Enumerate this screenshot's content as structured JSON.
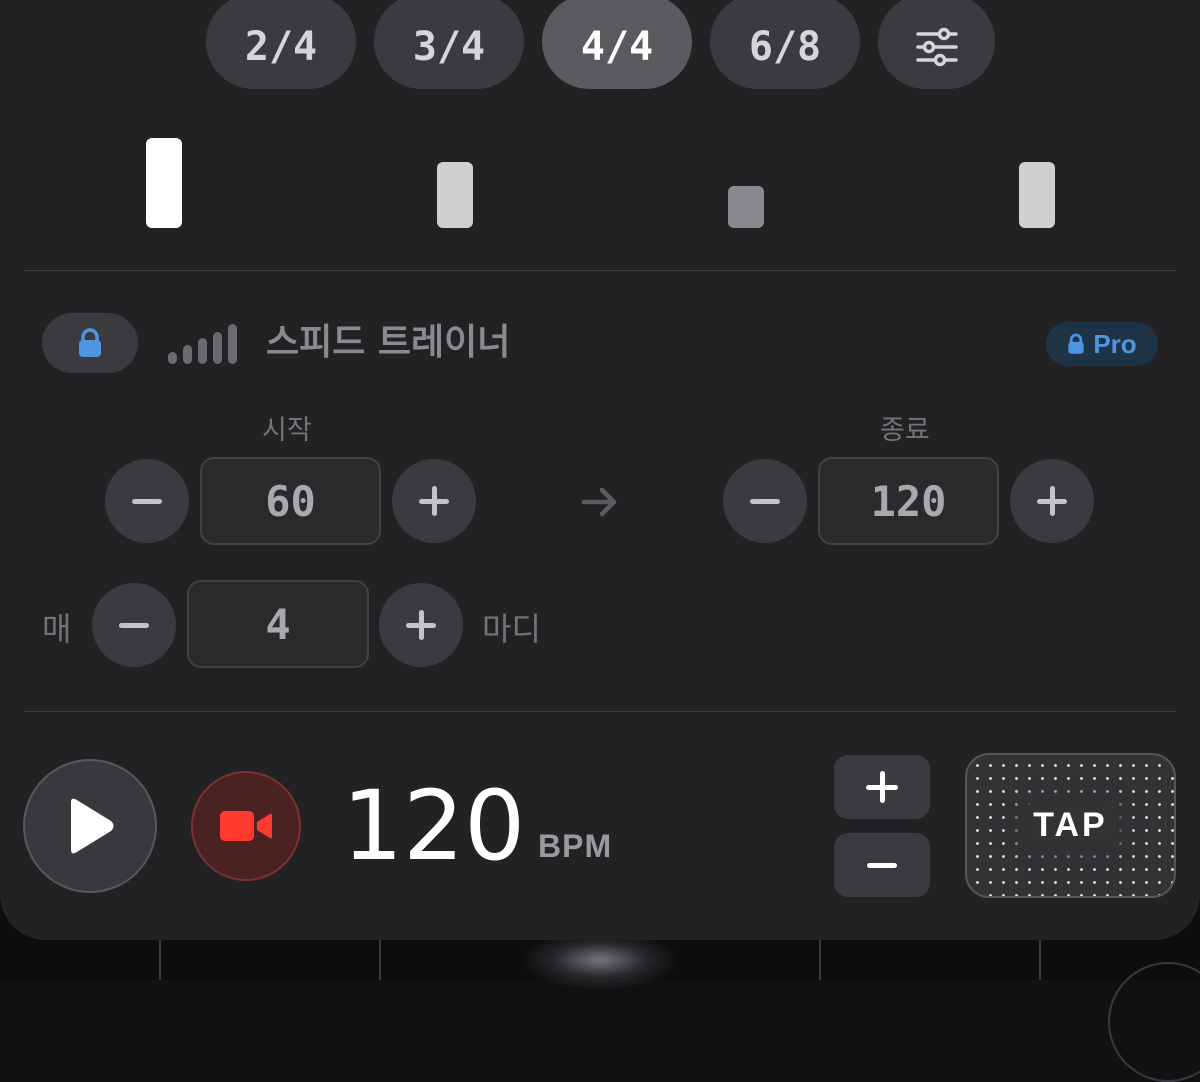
{
  "time_signatures": [
    {
      "label": "2/4",
      "active": false
    },
    {
      "label": "3/4",
      "active": false
    },
    {
      "label": "4/4",
      "active": true
    },
    {
      "label": "6/8",
      "active": false
    }
  ],
  "settings_icon": "sliders-icon",
  "beats": [
    {
      "accent": "strong",
      "color": "#ffffff"
    },
    {
      "accent": "medium",
      "color": "#cfcfd2"
    },
    {
      "accent": "weak",
      "color": "#8a8a8e"
    },
    {
      "accent": "medium",
      "color": "#cfcfd2"
    }
  ],
  "speed_trainer": {
    "title": "스피드 트레이너",
    "pro_label": "Pro",
    "start_label": "시작",
    "start_value": "60",
    "end_label": "종료",
    "end_value": "120",
    "every_prefix": "매",
    "every_value": "4",
    "every_suffix": "마디"
  },
  "transport": {
    "bpm": "120",
    "bpm_unit": "BPM",
    "tap_label": "TAP"
  },
  "colors": {
    "accent_blue": "#4e97e0",
    "record_red": "#ff3b30",
    "panel": "#222225"
  }
}
